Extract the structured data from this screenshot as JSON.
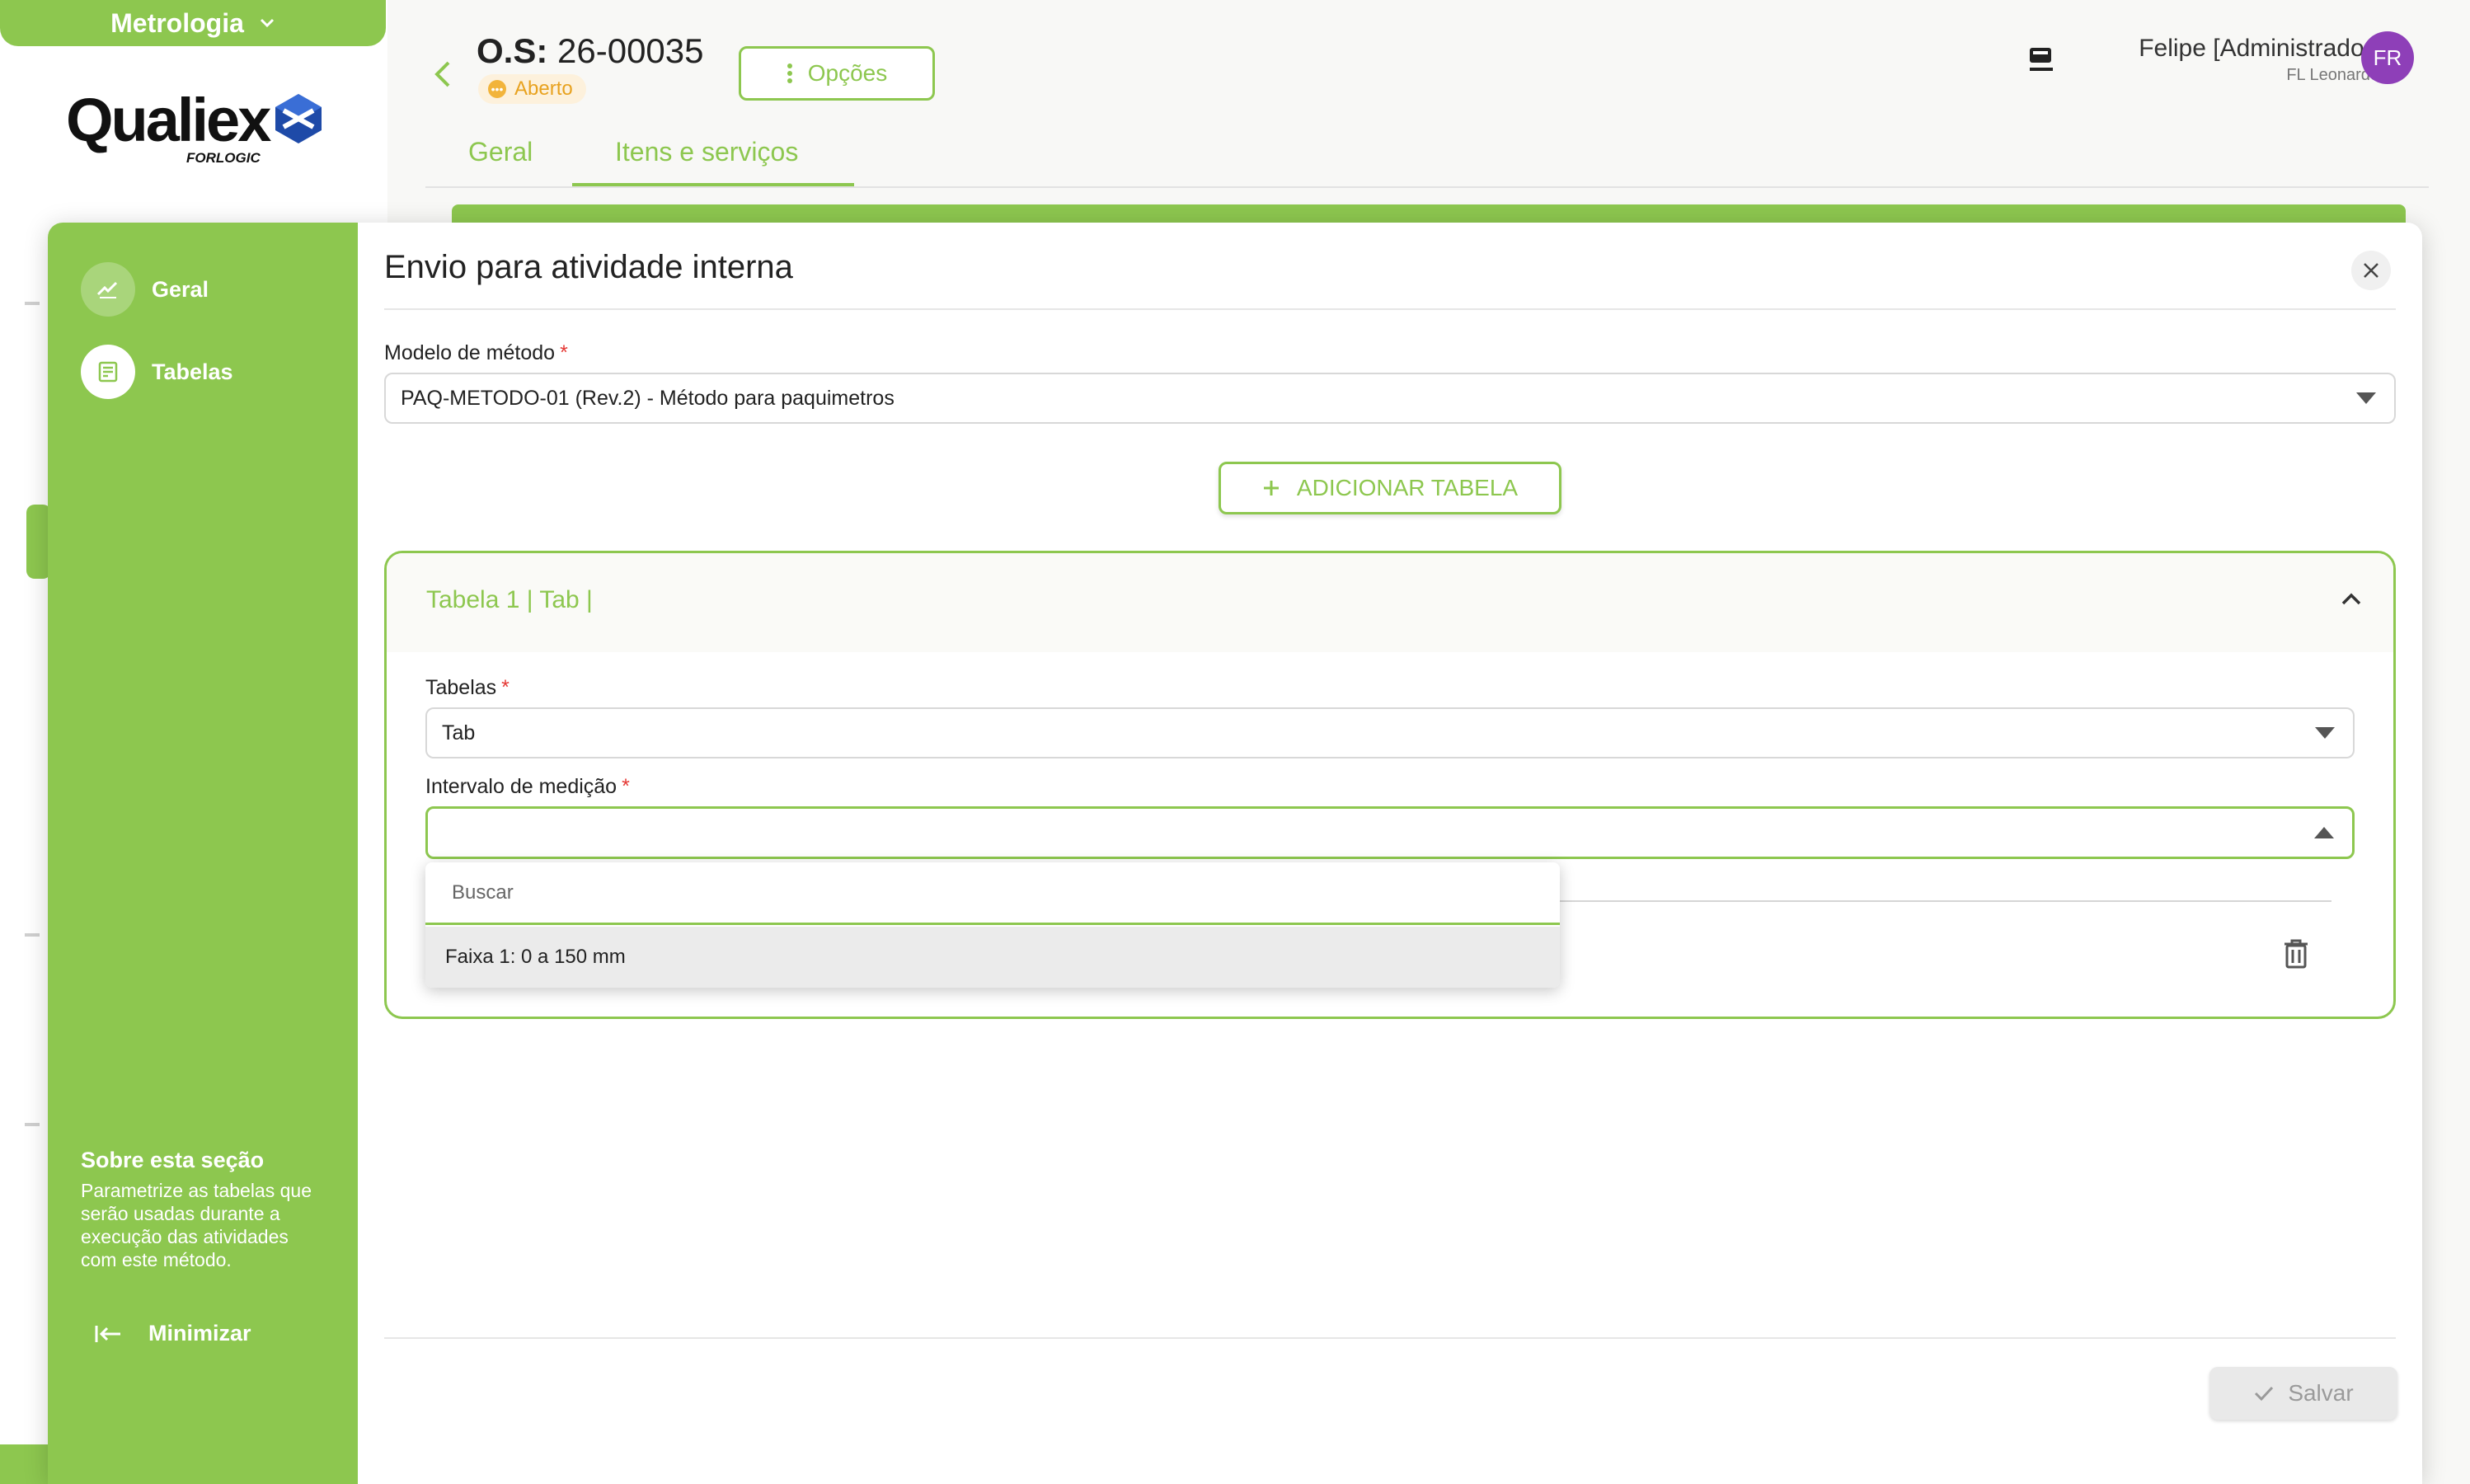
{
  "module": {
    "label": "Metrologia",
    "chevron_icon": "chevron-down-icon"
  },
  "logo": {
    "name": "Qualiex",
    "sub": "FORLOGIC"
  },
  "order": {
    "title_prefix": "O.S:",
    "number": "26-00035",
    "status": "Aberto",
    "options_label": "Opções"
  },
  "top_tabs": [
    {
      "label": "Geral",
      "active": false
    },
    {
      "label": "Itens e serviços",
      "active": true
    }
  ],
  "user": {
    "name": "Felipe [Administrador]",
    "company": "FL Leonardo",
    "initials": "FR"
  },
  "modal": {
    "title": "Envio para atividade interna",
    "side_nav": [
      {
        "label": "Geral",
        "icon": "edit-check-icon",
        "active": false
      },
      {
        "label": "Tabelas",
        "icon": "table-check-icon",
        "active": true
      }
    ],
    "about": {
      "title": "Sobre esta seção",
      "text": "Parametrize as tabelas que serão usadas durante a execução das atividades com este método."
    },
    "minimize_label": "Minimizar",
    "method_model": {
      "label": "Modelo de método",
      "value": "PAQ-METODO-01 (Rev.2) - Método para paquimetros"
    },
    "add_table_label": "ADICIONAR TABELA",
    "table_card": {
      "title": "Tabela 1 | Tab |",
      "tables_label": "Tabelas",
      "tables_value": "Tab",
      "interval_label": "Intervalo de medição",
      "interval_value": ""
    },
    "dropdown": {
      "search_placeholder": "Buscar",
      "options": [
        "Faixa 1: 0 a 150 mm"
      ]
    },
    "save_label": "Salvar"
  },
  "colors": {
    "accent": "#8dc74f",
    "avatar": "#8e3fb8",
    "status": "#f2b43b",
    "required": "#e53935"
  }
}
